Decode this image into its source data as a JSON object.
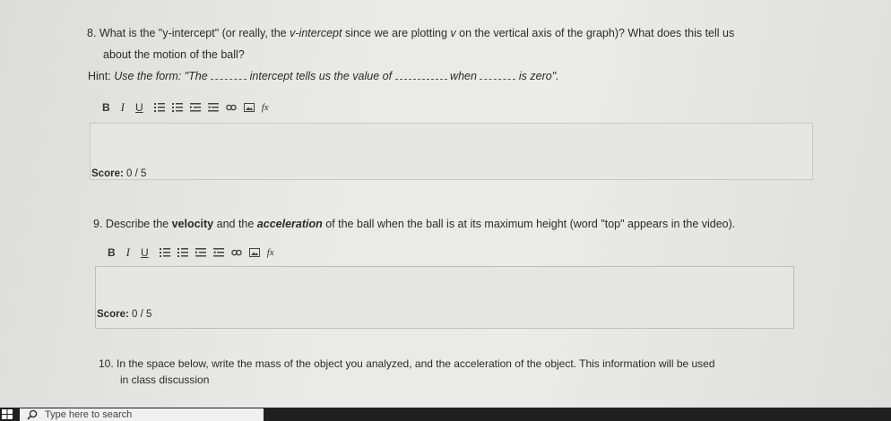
{
  "q8": {
    "number": "8.",
    "line1": "What is the \"y-intercept\" (or really, the ",
    "line1_em": "v-intercept",
    "line1_b": " since we are plotting ",
    "line1_v": "v",
    "line1_c": " on the vertical axis of the graph)? What does this tell us",
    "line2": "about the motion of the ball?",
    "hint_label": "Hint:",
    "hint_a": "Use the form: \"The",
    "hint_b": "intercept tells us the value of",
    "hint_c": "when",
    "hint_d": "is zero\".",
    "score_label": "Score:",
    "score_value": "0 / 5"
  },
  "q9": {
    "number": "9.",
    "a": "Describe the ",
    "velocity": "velocity",
    "b": " and the ",
    "acceleration": "acceleration",
    "c": " of the ball when the ball is at its maximum height (word \"top\" appears in the video).",
    "score_label": "Score:",
    "score_value": "0 / 5"
  },
  "q10": {
    "number": "10.",
    "line1": "In the space below, write the mass of the object you analyzed, and the acceleration of the object. This information will be used",
    "line2": "in class discussion"
  },
  "toolbar": {
    "bold": "B",
    "italic": "I",
    "underline": "U",
    "fx": "fx"
  },
  "taskbar": {
    "search_placeholder": "Type here to search"
  }
}
